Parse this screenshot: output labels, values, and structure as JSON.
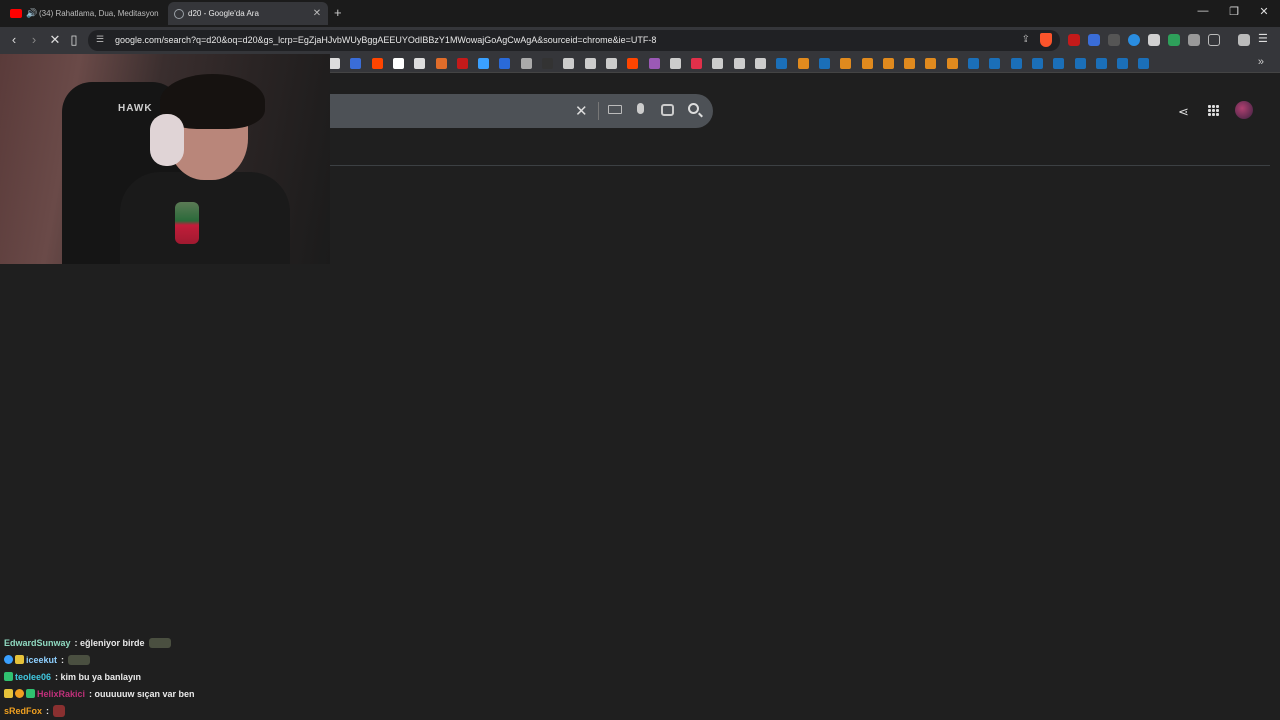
{
  "tabs": [
    {
      "title": "(34) Rahatlama, Dua, Meditasyon",
      "favicon_color": "#ff0000",
      "audio": true,
      "active": false
    },
    {
      "title": "d20 - Google'da Ara",
      "favicon_color": "#9aa0a6",
      "audio": false,
      "active": true
    }
  ],
  "toolbar": {
    "url": "google.com/search?q=d20&oq=d20&gs_lcrp=EgZjaHJvbWUyBggAEEUYOdIBBzY1MWowajGoAgCwAgA&sourceid=chrome&ie=UTF-8"
  },
  "bookmark_count": 39,
  "chat": [
    {
      "user": "EdwardSunway",
      "user_color": "#8fd9c0",
      "text": ": eğleniyor birde",
      "badges": [],
      "emote": true
    },
    {
      "user": "iceekut",
      "user_color": "#8fd0ff",
      "text": ":",
      "badges": [
        "#3aa0ff",
        "#e6c23a"
      ],
      "emote": true
    },
    {
      "user": "teolee06",
      "user_color": "#40c8e0",
      "text": ": kim bu ya banlayın",
      "badges": [
        "#30c070"
      ],
      "emote": false
    },
    {
      "user": "HelixRakici",
      "user_color": "#c0307a",
      "text": ": ouuuuuw sıçan var ben",
      "badges": [
        "#e6c23a",
        "#f0a020",
        "#30c070"
      ],
      "emote": false
    },
    {
      "user": "sRedFox",
      "user_color": "#f0a020",
      "text": ":",
      "badges": [],
      "emote": true
    }
  ],
  "webcam_logo": "HAWK"
}
